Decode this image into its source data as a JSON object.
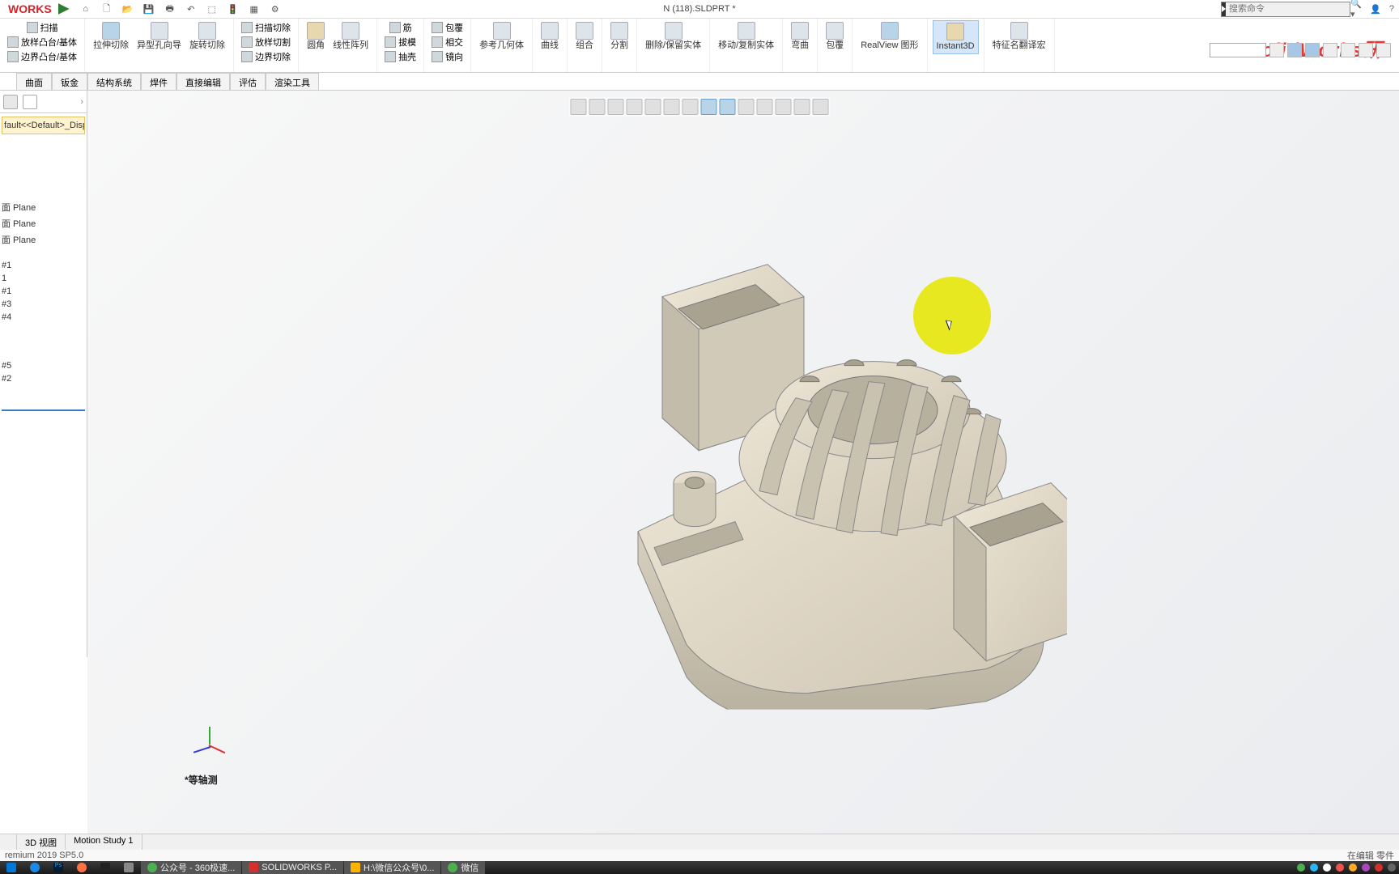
{
  "titlebar": {
    "logo": "WORKS",
    "doc_title": "N (118).SLDPRT *",
    "search_placeholder": "搜索命令"
  },
  "qat": [
    "home-icon",
    "new-icon",
    "open-icon",
    "save-icon",
    "print-icon",
    "undo-icon",
    "select-icon",
    "rebuild-icon",
    "options-icon",
    "settings-icon"
  ],
  "ribbon": {
    "groups": [
      {
        "items": [
          {
            "label": "扫描"
          },
          {
            "label": "放样凸台/基体"
          },
          {
            "label": "边界凸台/基体"
          }
        ]
      },
      {
        "items": [
          {
            "label": "拉伸切除"
          },
          {
            "label": "异型孔向导"
          },
          {
            "label": "旋转切除"
          }
        ]
      },
      {
        "items": [
          {
            "label": "扫描切除"
          },
          {
            "label": "放样切割"
          },
          {
            "label": "边界切除"
          }
        ]
      },
      {
        "items": [
          {
            "label": "圆角"
          },
          {
            "label": "线性阵列"
          }
        ]
      },
      {
        "items": [
          {
            "label": "筋"
          },
          {
            "label": "拔模"
          },
          {
            "label": "抽壳"
          }
        ]
      },
      {
        "items": [
          {
            "label": "包覆"
          },
          {
            "label": "相交"
          },
          {
            "label": "镜向"
          }
        ]
      },
      {
        "items": [
          {
            "label": "参考几何体"
          }
        ]
      },
      {
        "items": [
          {
            "label": "曲线"
          }
        ]
      },
      {
        "items": [
          {
            "label": "组合"
          }
        ]
      },
      {
        "items": [
          {
            "label": "分割"
          }
        ]
      },
      {
        "items": [
          {
            "label": "删除/保留实体"
          }
        ]
      },
      {
        "items": [
          {
            "label": "移动/复制实体"
          }
        ]
      },
      {
        "items": [
          {
            "label": "弯曲"
          }
        ]
      },
      {
        "items": [
          {
            "label": "包覆"
          }
        ]
      },
      {
        "items": [
          {
            "label": "RealView 图形"
          }
        ]
      },
      {
        "items": [
          {
            "label": "Instant3D"
          }
        ],
        "active": true
      },
      {
        "items": [
          {
            "label": "特征名翻译宏"
          }
        ]
      }
    ]
  },
  "tabs": [
    "曲面",
    "钣金",
    "结构系统",
    "焊件",
    "直接编辑",
    "评估",
    "渲染工具"
  ],
  "tree": {
    "config": "fault<<Default>_Displa",
    "items": [
      "面 Plane",
      "面 Plane",
      "面 Plane",
      "",
      "#1",
      "1",
      "#1",
      "#3",
      "#4",
      "",
      "",
      "#5",
      "#2"
    ]
  },
  "view_label": "*等轴测",
  "bottom_tabs": [
    "",
    "3D 视图",
    "Motion Study 1"
  ],
  "status": {
    "left": "remium 2019 SP5.0",
    "right": "在编辑 零件"
  },
  "taskbar": [
    {
      "label": "",
      "color": "#0078d7"
    },
    {
      "label": "",
      "color": "#1e88e5"
    },
    {
      "label": "",
      "color": "#001e36",
      "text": "Ps"
    },
    {
      "label": "",
      "color": "#ff7043"
    },
    {
      "label": "",
      "color": "#222"
    },
    {
      "label": "",
      "color": "#888"
    },
    {
      "label": "公众号 - 360极速...",
      "color": "#4caf50"
    },
    {
      "label": "SOLIDWORKS P...",
      "color": "#d32f2f"
    },
    {
      "label": "H:\\微信公众号\\0...",
      "color": "#ffb300"
    },
    {
      "label": "微信",
      "color": "#4caf50"
    }
  ],
  "watermark": "SolidWorks研"
}
